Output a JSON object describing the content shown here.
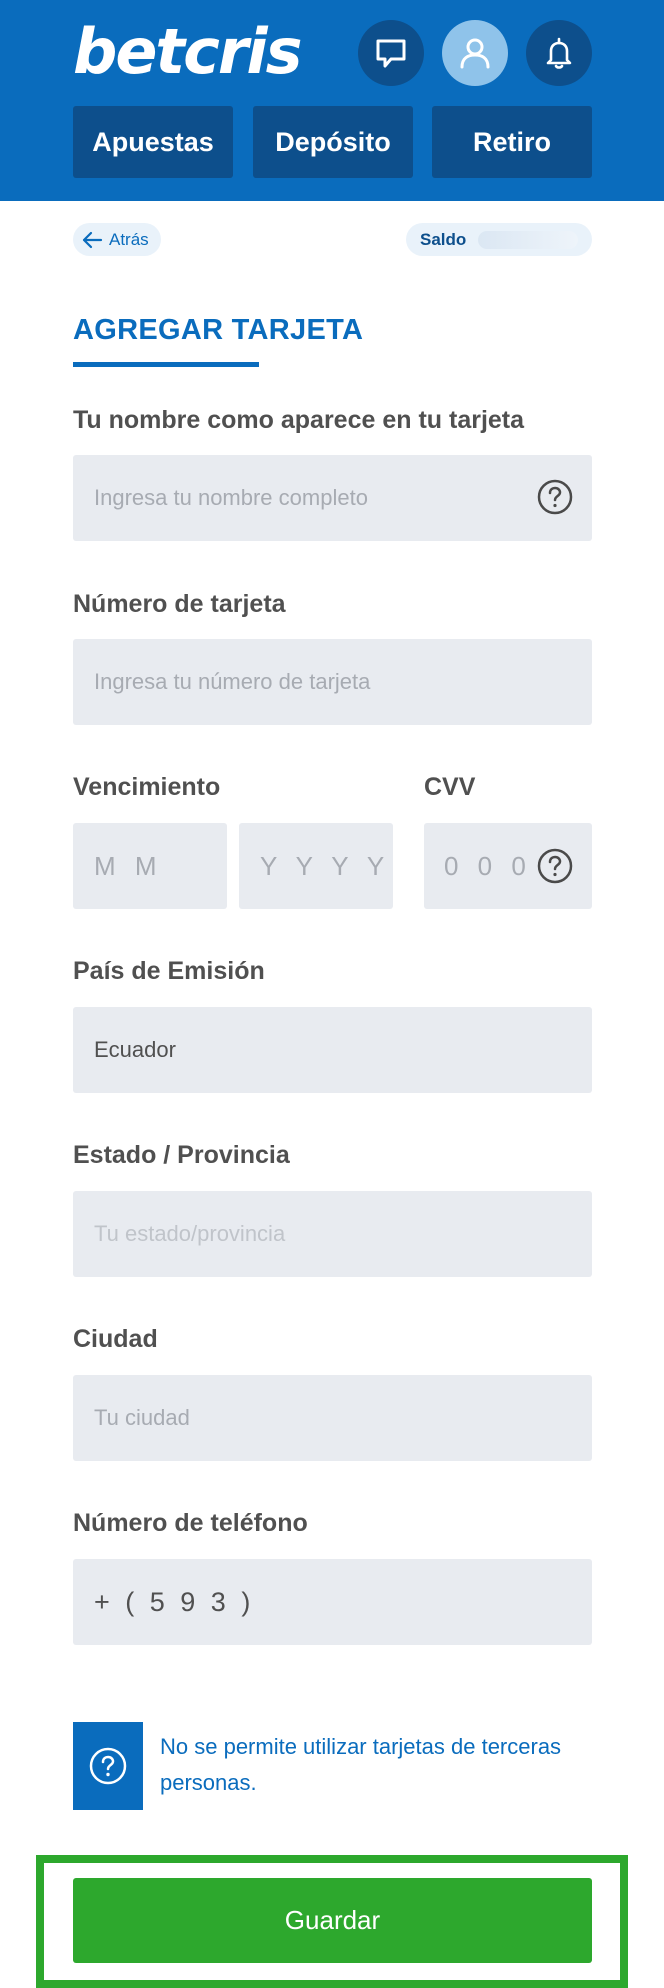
{
  "header": {
    "logo_text": "betcris",
    "icons": [
      "chat-icon",
      "user-icon",
      "bell-icon"
    ],
    "nav": {
      "apuestas": "Apuestas",
      "deposito": "Depósito",
      "retiro": "Retiro"
    }
  },
  "subheader": {
    "back_label": "Atrás",
    "saldo_label": "Saldo"
  },
  "title": "AGREGAR TARJETA",
  "form": {
    "name": {
      "label": "Tu nombre como aparece en tu tarjeta",
      "placeholder": "Ingresa tu nombre completo"
    },
    "card_number": {
      "label": "Número de tarjeta",
      "placeholder": "Ingresa tu número de tarjeta"
    },
    "expiry": {
      "label": "Vencimiento",
      "month_placeholder": "M M",
      "year_placeholder": "Y Y Y Y"
    },
    "cvv": {
      "label": "CVV",
      "placeholder": "0 0 0"
    },
    "country": {
      "label": "País de Emisión",
      "value": "Ecuador"
    },
    "state": {
      "label": "Estado / Provincia",
      "placeholder": "Tu estado/provincia"
    },
    "city": {
      "label": "Ciudad",
      "placeholder": "Tu ciudad"
    },
    "phone": {
      "label": "Número de teléfono",
      "value": "+ ( 5 9 3 )"
    }
  },
  "info": {
    "text": "No se permite utilizar tarjetas de terceras personas."
  },
  "save_label": "Guardar",
  "colors": {
    "brand_blue": "#0a6cbd",
    "dark_blue": "#0d4f8c",
    "save_green": "#2da82d",
    "field_bg": "#e8ebf0"
  }
}
